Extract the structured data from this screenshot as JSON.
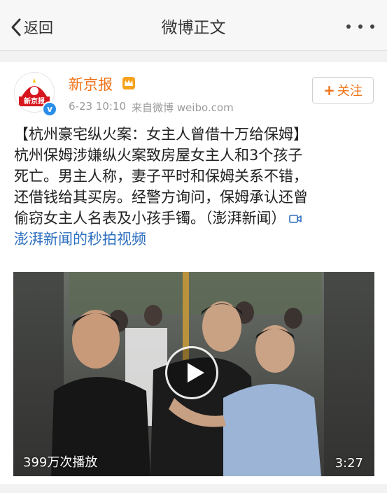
{
  "nav": {
    "back_label": "返回",
    "title": "微博正文"
  },
  "post": {
    "author": "新京报",
    "avatar_text": "新京报",
    "time": "6-23 10:10",
    "source": "来自微博 weibo.com",
    "follow_plus": "+",
    "follow_label": "关注",
    "text_lines": [
      "【杭州豪宅纵火案：女主人曾借十万给保姆】",
      "杭州保姆涉嫌纵火案致房屋女主人和3个孩子",
      "死亡。男主人称，妻子平时和保姆关系不错，",
      "还借钱给其买房。经警方询问，保姆承认还曾",
      "偷窃女主人名表及小孩手镯。（澎湃新闻）"
    ],
    "video_link": "澎湃新闻的秒拍视频"
  },
  "video": {
    "play_count": "399万次播放",
    "duration": "3:27"
  },
  "colors": {
    "accent_orange": "#f07116",
    "link_blue": "#2d6fbf",
    "verified_blue": "#2b8ee8"
  }
}
